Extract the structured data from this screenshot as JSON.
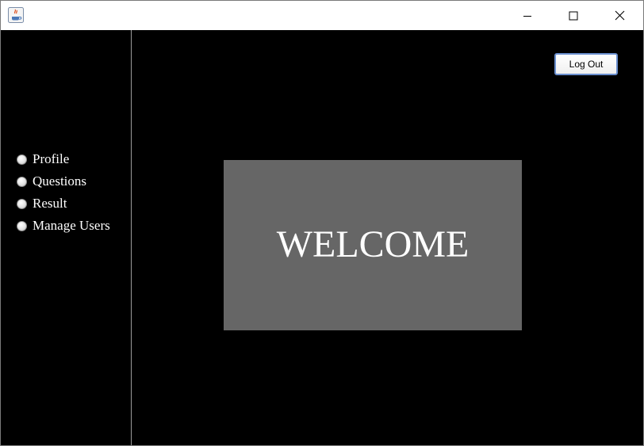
{
  "window": {
    "title": "",
    "controls": [
      "minimize-icon",
      "maximize-icon",
      "close-icon"
    ]
  },
  "sidebar": {
    "items": [
      {
        "label": "Profile",
        "checked": false
      },
      {
        "label": "Questions",
        "checked": false
      },
      {
        "label": "Result",
        "checked": false
      },
      {
        "label": "Manage Users",
        "checked": false
      }
    ]
  },
  "header": {
    "logout_label": "Log Out"
  },
  "main": {
    "welcome_text": "WELCOME"
  },
  "colors": {
    "background": "#000000",
    "panel": "#666666",
    "text": "#ffffff",
    "button_border": "#6a8fcf"
  }
}
